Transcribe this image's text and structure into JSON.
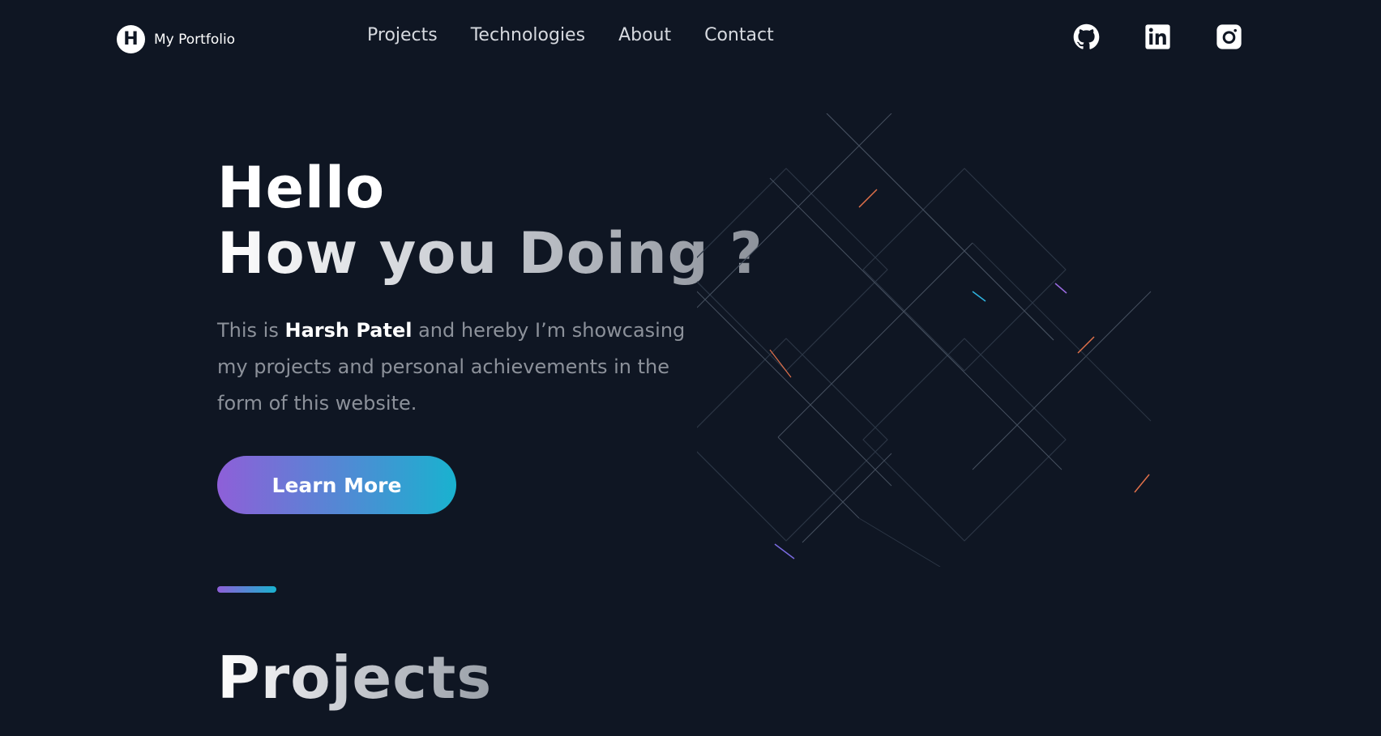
{
  "header": {
    "logo_letter": "H",
    "logo_text": "My Portfolio",
    "nav": [
      {
        "label": "Projects"
      },
      {
        "label": "Technologies"
      },
      {
        "label": "About"
      },
      {
        "label": "Contact"
      }
    ],
    "socials": [
      {
        "icon": "github-icon"
      },
      {
        "icon": "linkedin-icon"
      },
      {
        "icon": "instagram-icon"
      }
    ]
  },
  "hero": {
    "line1": "Hello",
    "line2": "How you Doing ?",
    "desc_before": "This is ",
    "name": "Harsh Patel",
    "desc_after": " and hereby I’m showcasing my projects and personal achievements in the form of this website.",
    "cta_label": "Learn More"
  },
  "projects": {
    "title": "Projects"
  },
  "colors": {
    "background": "#0f1623",
    "gradient_start": "#8e5fd8",
    "gradient_end": "#19b2cf",
    "muted_text": "#8c919a"
  }
}
